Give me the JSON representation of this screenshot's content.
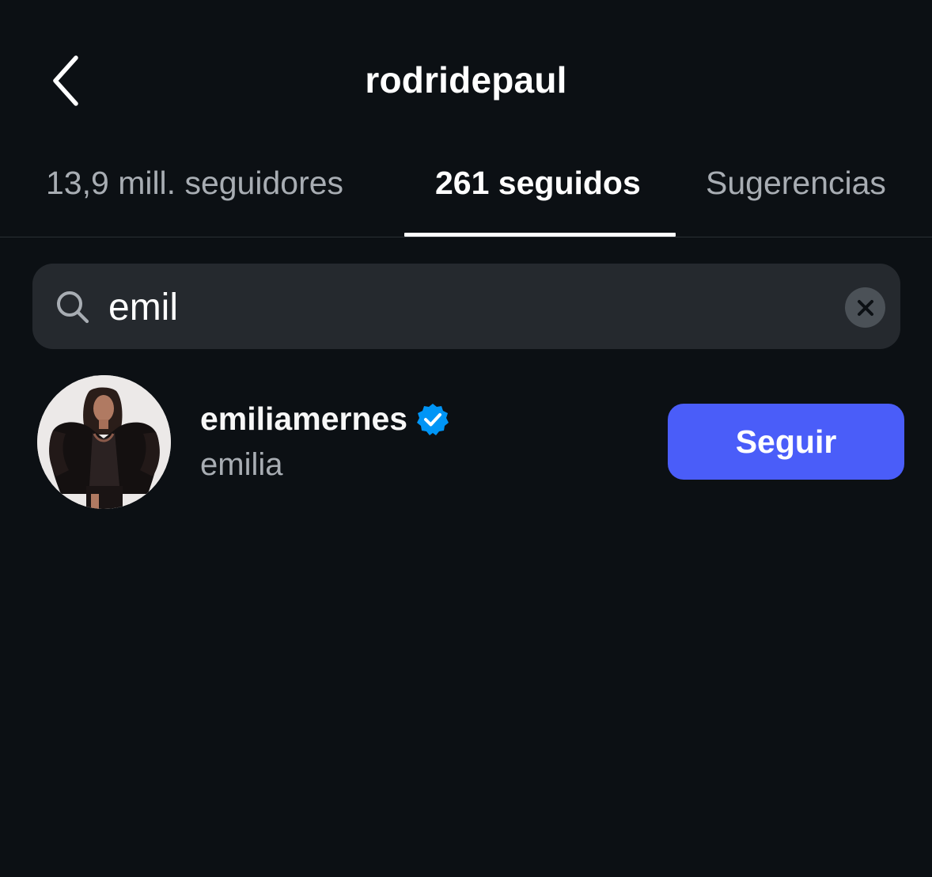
{
  "header": {
    "title": "rodridepaul",
    "back_icon": "chevron-left-icon"
  },
  "tabs": [
    {
      "label": "13,9 mill. seguidores",
      "active": false
    },
    {
      "label": "261 seguidos",
      "active": true
    },
    {
      "label": "Sugerencias",
      "active": false
    }
  ],
  "search": {
    "value": "emil",
    "icon": "search-icon",
    "clear_icon": "close-icon"
  },
  "results": [
    {
      "username": "emiliamernes",
      "full_name": "emilia",
      "verified": true,
      "button_label": "Seguir"
    }
  ],
  "colors": {
    "background": "#0c1014",
    "search_background": "#25292e",
    "accent_button": "#4a5df9",
    "verified_badge": "#0095f6",
    "secondary_text": "#a8adb3"
  }
}
